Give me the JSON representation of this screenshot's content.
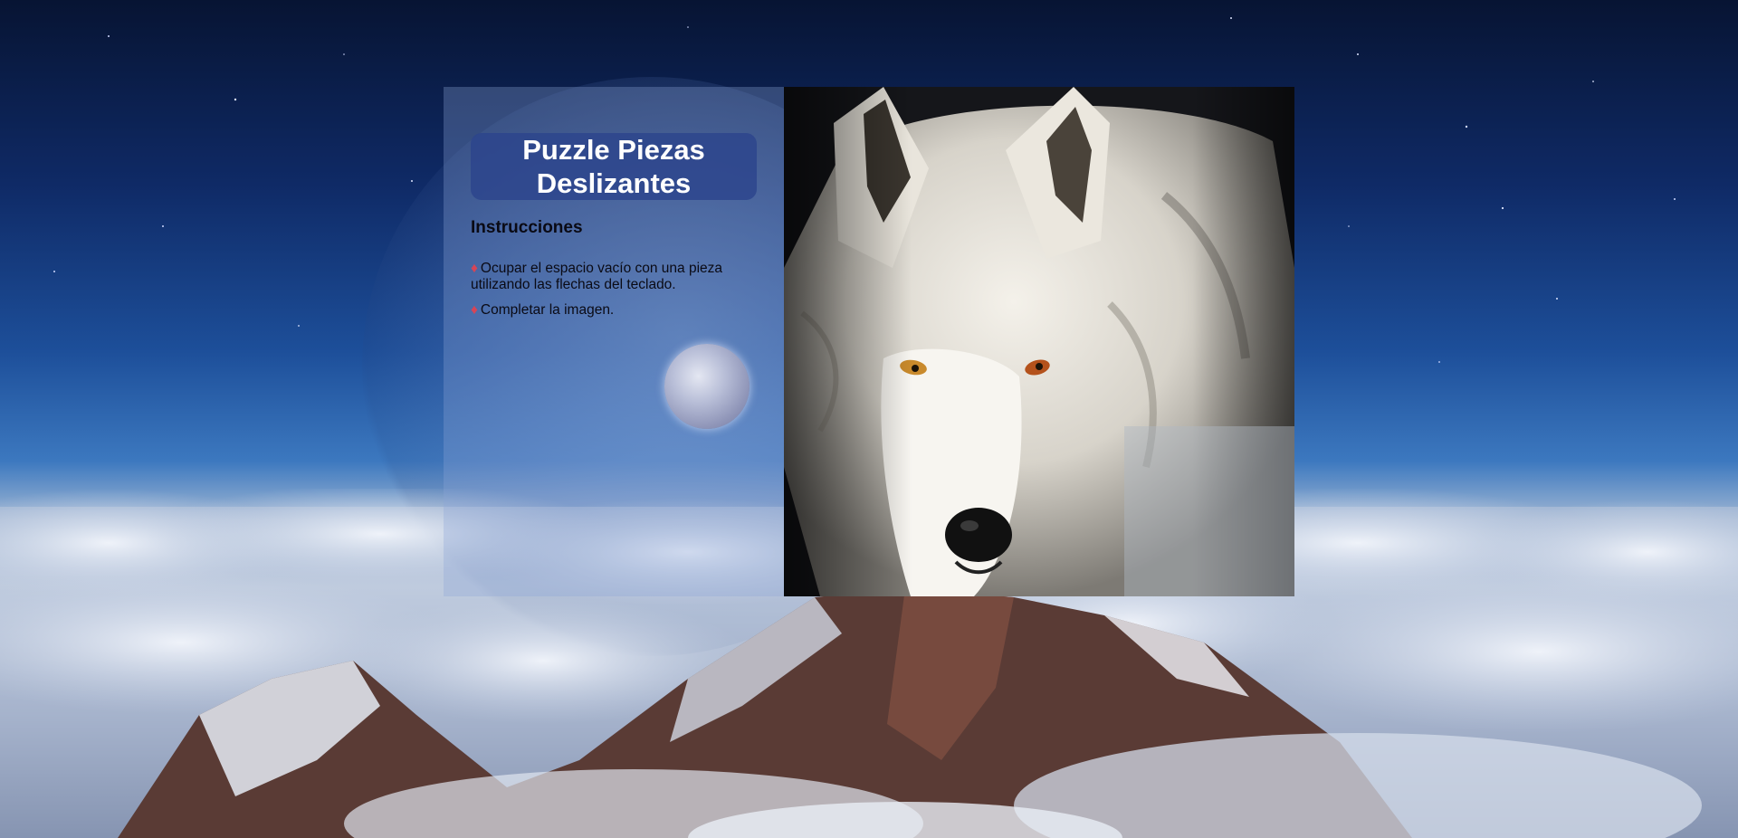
{
  "game": {
    "title": "Puzzle Piezas Deslizantes",
    "title_line1": "Puzzle Piezas",
    "title_line2": "Deslizantes",
    "instructions": {
      "heading": "Instrucciones",
      "bullet_symbol": "♦",
      "items": [
        "Ocupar el espacio vacío con una pieza utilizando las flechas del teclado.",
        "Completar la imagen."
      ]
    }
  },
  "board": {
    "image": "white-wolf",
    "grid": "3x3",
    "empty_tile": "bottom-right"
  },
  "colors": {
    "title_bg": "#2c448c",
    "bullet": "#d64557",
    "panel": "#8ca5d7"
  }
}
